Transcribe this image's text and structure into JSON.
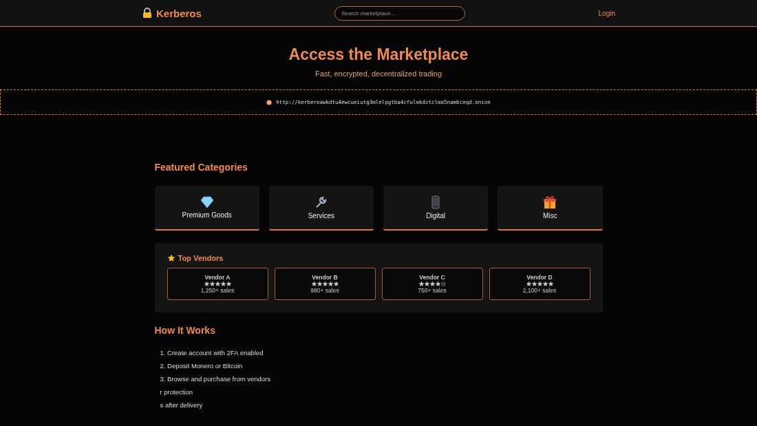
{
  "header": {
    "brand": "Kerberos",
    "search": {
      "placeholder": "Search marketplace..."
    },
    "login": "Login"
  },
  "hero": {
    "title": "Access the Marketplace",
    "subtitle": "Fast, encrypted, decentralized trading"
  },
  "onion_address": "http://kerberoawkdtu4ewcueiutg3mlelpgtba4cfulmkdztclmo5nambceqd.onion",
  "featured": {
    "title": "Featured Categories",
    "categories": [
      {
        "kind": "diamond",
        "label": "Premium Goods"
      },
      {
        "kind": "wrench",
        "label": "Services"
      },
      {
        "kind": "phone",
        "label": "Digital"
      },
      {
        "kind": "gift",
        "label": "Misc"
      }
    ]
  },
  "vendors": {
    "title": "Top Vendors",
    "items": [
      {
        "name": "Vendor A",
        "stars": 5,
        "sales": "1,250+ sales"
      },
      {
        "name": "Vendor B",
        "stars": 5,
        "sales": "980+ sales"
      },
      {
        "name": "Vendor C",
        "stars": 4,
        "sales": "750+ sales"
      },
      {
        "name": "Vendor D",
        "stars": 5,
        "sales": "2,100+ sales"
      }
    ]
  },
  "how_it_works": {
    "title": "How It Works",
    "steps": [
      "1. Create account with 2FA enabled",
      "2. Deposit Monero or Bitcoin",
      "3. Browse and purchase from vendors",
      "r protection",
      "s after delivery"
    ]
  }
}
